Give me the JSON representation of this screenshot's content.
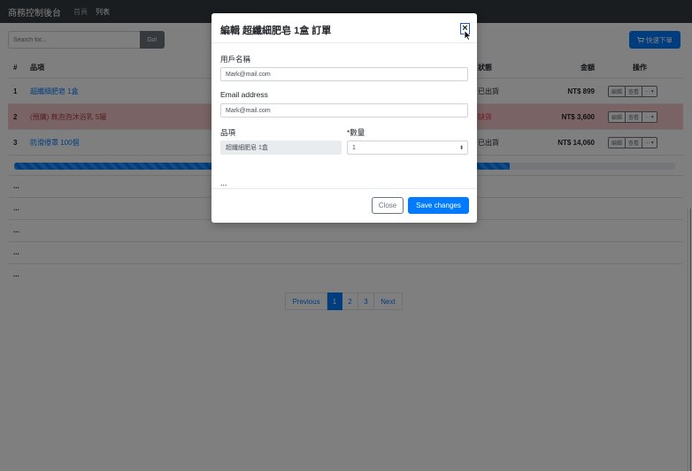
{
  "navbar": {
    "brand": "商務控制後台",
    "links": [
      "首頁",
      "列表"
    ]
  },
  "toolbar": {
    "search_placeholder": "Search for...",
    "go_label": "Go!",
    "quick_order_label": "快速下單"
  },
  "table": {
    "headers": {
      "num": "#",
      "item": "品項",
      "status": "狀態",
      "amount": "金額",
      "ops": "操作"
    },
    "rows": [
      {
        "num": "1",
        "item": "超纖細肥皂 1盒",
        "status": "已出貨",
        "amount": "NT$ 899"
      },
      {
        "num": "2",
        "item": "(預購) 無泡泡沐浴乳 5罐",
        "status": "缺貨",
        "amount": "NT$ 3,600"
      },
      {
        "num": "3",
        "item": "防滑燈罩 100個",
        "status": "已出貨",
        "amount": "NT$ 14,060"
      }
    ],
    "row_buttons": {
      "edit": "編輯",
      "view": "查看",
      "more": "..."
    },
    "progress": 0.75,
    "ellipsis": "..."
  },
  "pagination": {
    "previous": "Previous",
    "pages": [
      "1",
      "2",
      "3"
    ],
    "next": "Next",
    "active": "1"
  },
  "modal": {
    "title": "編輯 超纖細肥皂 1盒 訂單",
    "close_symbol": "×",
    "username_label": "用戶名稱",
    "username_value": "Mark@mail.com",
    "email_label": "Email address",
    "email_value": "Mark@mail.com",
    "item_label": "品項",
    "item_value": "超纖細肥皂 1盒",
    "qty_label": "*數量",
    "qty_value": "1",
    "ellipsis": "...",
    "close_button": "Close",
    "save_button": "Save changes"
  },
  "colors": {
    "primary": "#007bff",
    "danger_row": "#f5c6cb",
    "navbar": "#343a40"
  }
}
